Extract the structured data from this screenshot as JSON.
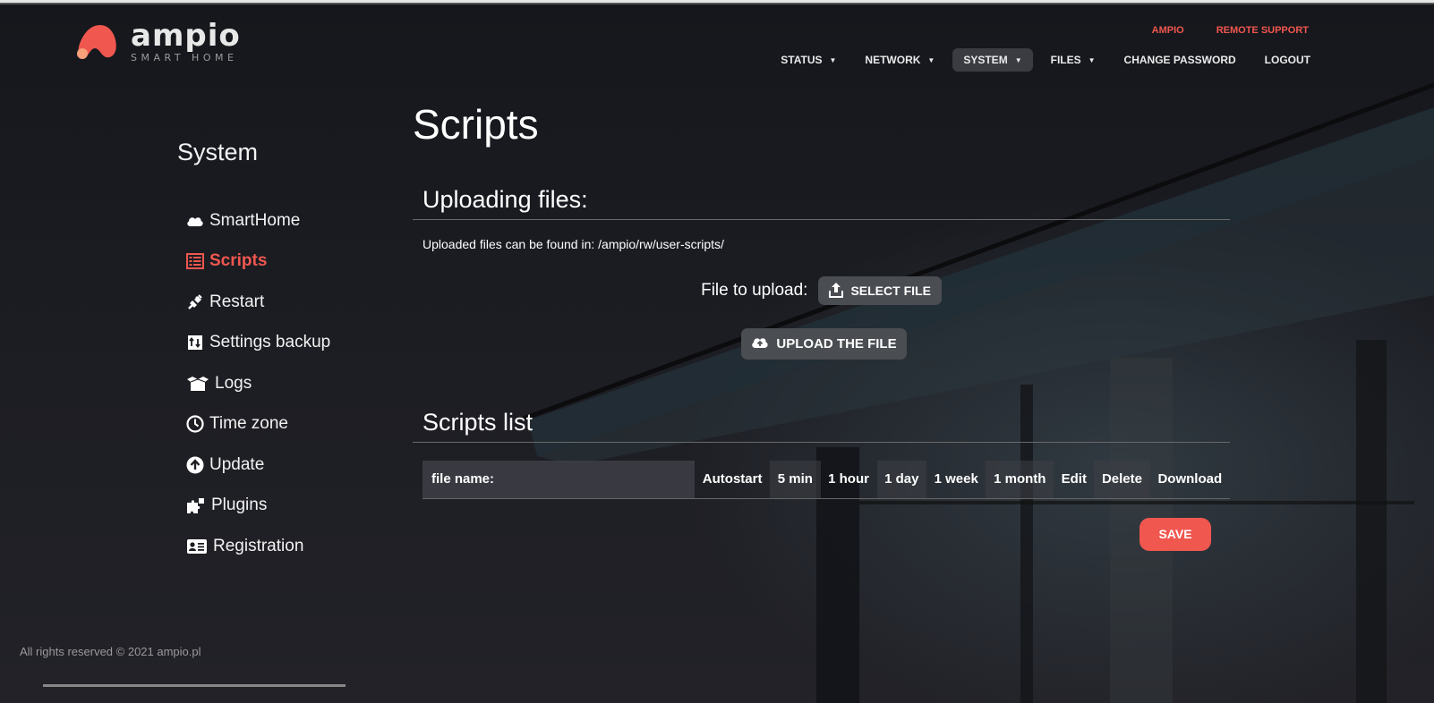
{
  "brand": {
    "name": "ampio",
    "tagline": "SMART HOME",
    "accent": "#f0574f"
  },
  "top_links": [
    "AMPIO",
    "REMOTE SUPPORT"
  ],
  "nav": [
    {
      "label": "STATUS",
      "dropdown": true
    },
    {
      "label": "NETWORK",
      "dropdown": true
    },
    {
      "label": "SYSTEM",
      "dropdown": true,
      "active": true
    },
    {
      "label": "FILES",
      "dropdown": true
    },
    {
      "label": "CHANGE PASSWORD",
      "dropdown": false
    },
    {
      "label": "LOGOUT",
      "dropdown": false
    }
  ],
  "sidebar": {
    "title": "System",
    "items": [
      {
        "label": "SmartHome",
        "icon": "cloud-icon"
      },
      {
        "label": "Scripts",
        "icon": "list-icon",
        "active": true
      },
      {
        "label": "Restart",
        "icon": "plug-icon"
      },
      {
        "label": "Settings backup",
        "icon": "backup-icon"
      },
      {
        "label": "Logs",
        "icon": "box-icon"
      },
      {
        "label": "Time zone",
        "icon": "clock-icon"
      },
      {
        "label": "Update",
        "icon": "arrow-up-circle-icon"
      },
      {
        "label": "Plugins",
        "icon": "puzzle-icon"
      },
      {
        "label": "Registration",
        "icon": "id-card-icon"
      }
    ]
  },
  "main": {
    "title": "Scripts",
    "upload_section": {
      "heading": "Uploading files:",
      "info": "Uploaded files can be found in: /ampio/rw/user-scripts/",
      "file_label": "File to upload:",
      "select_button": "SELECT FILE",
      "upload_button": "UPLOAD THE FILE"
    },
    "list_section": {
      "heading": "Scripts list",
      "columns": [
        "file name:",
        "Autostart",
        "5 min",
        "1 hour",
        "1 day",
        "1 week",
        "1 month",
        "Edit",
        "Delete",
        "Download"
      ],
      "save_button": "SAVE"
    }
  },
  "footer": "All rights reserved © 2021 ampio.pl"
}
